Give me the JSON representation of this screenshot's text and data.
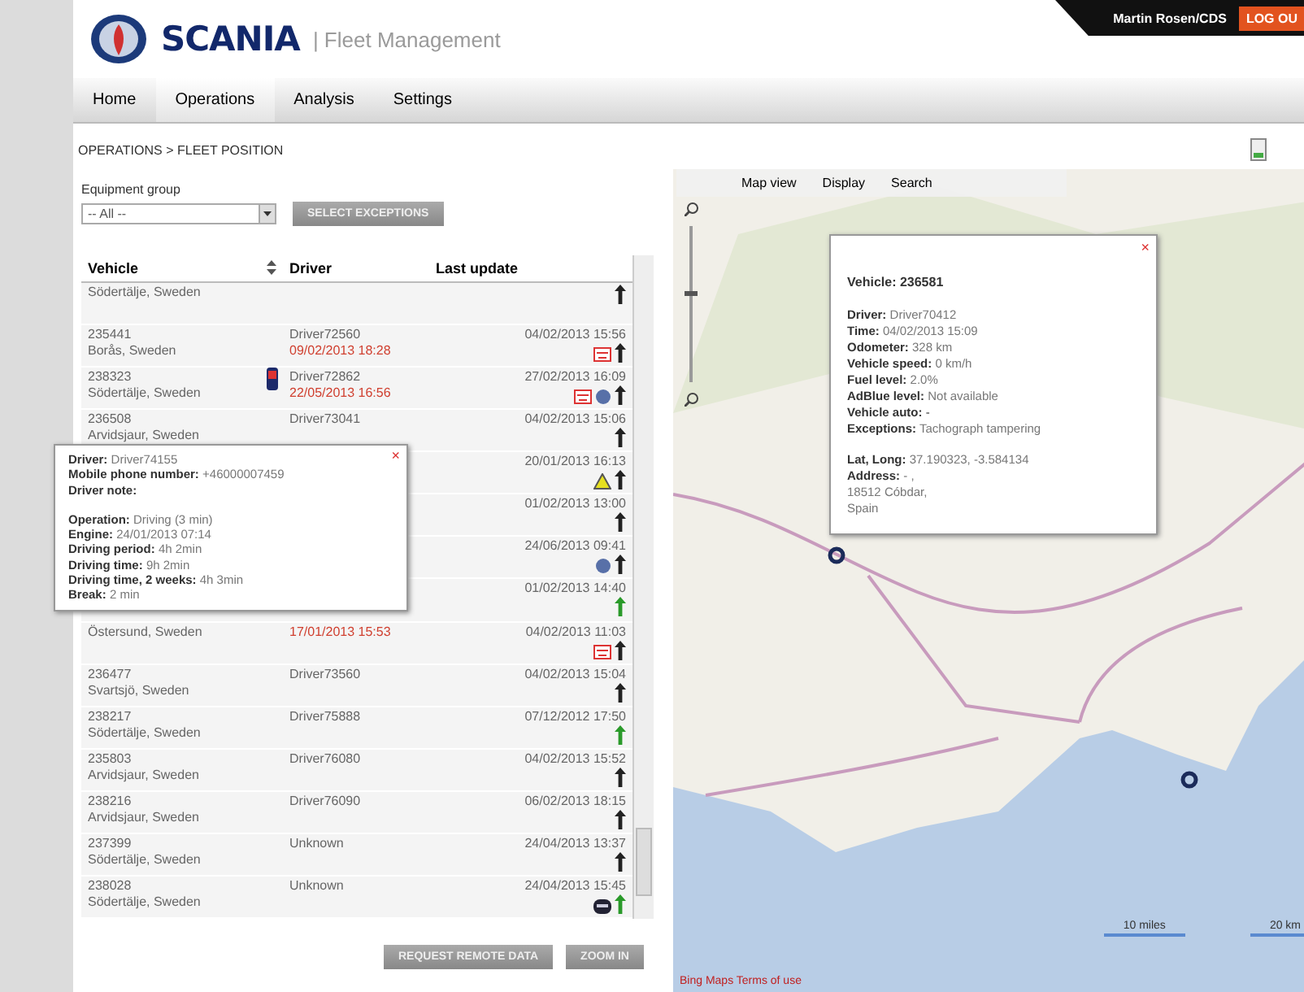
{
  "header": {
    "logo": "SCANIA",
    "app_title": "| Fleet Management",
    "user": "Martin Rosen/CDS",
    "logout": "LOG OU"
  },
  "nav": [
    {
      "label": "Home",
      "selected": false
    },
    {
      "label": "Operations",
      "selected": true
    },
    {
      "label": "Analysis",
      "selected": false
    },
    {
      "label": "Settings",
      "selected": false
    }
  ],
  "breadcrumb": "OPERATIONS > FLEET POSITION",
  "filter": {
    "label": "Equipment group",
    "value": "-- All --",
    "button": "SELECT EXCEPTIONS"
  },
  "list": {
    "columns": [
      "Vehicle",
      "Driver",
      "Last update"
    ],
    "rows": [
      {
        "location": "Södertälje, Sweden",
        "color": "#222222",
        "icons": []
      },
      {
        "vehicle": "235441",
        "location": "Borås, Sweden",
        "driver": "Driver72560",
        "driver_note": "09/02/2013 18:28",
        "time": "04/02/2013 15:56",
        "color": "#222222",
        "icons": [
          {
            "kind": "tacho"
          }
        ]
      },
      {
        "vehicle": "238323",
        "location": "Södertälje, Sweden",
        "driver": "Driver72862",
        "driver_note": "22/05/2013 16:56",
        "time": "27/02/2013 16:09",
        "color": "#222222",
        "phone": true,
        "icons": [
          {
            "kind": "tacho"
          },
          {
            "kind": "dot"
          }
        ]
      },
      {
        "vehicle": "236508",
        "location": "Arvidsjaur, Sweden",
        "driver": "Driver73041",
        "time": "04/02/2013 15:06",
        "color": "#222222",
        "icons": []
      },
      {
        "time": "20/01/2013 16:13",
        "color": "#222222",
        "icons": [
          {
            "kind": "warning"
          }
        ]
      },
      {
        "time": "01/02/2013 13:00",
        "color": "#222222",
        "icons": []
      },
      {
        "time": "24/06/2013 09:41",
        "color": "#222222",
        "icons": [
          {
            "kind": "dot"
          }
        ]
      },
      {
        "time": "01/02/2013 14:40",
        "color": "#2a9a2a",
        "icons": []
      },
      {
        "location": "Östersund, Sweden",
        "driver_note": "17/01/2013 15:53",
        "time": "04/02/2013 11:03",
        "color": "#222222",
        "icons": [
          {
            "kind": "tacho"
          }
        ]
      },
      {
        "vehicle": "236477",
        "location": "Svartsjö, Sweden",
        "driver": "Driver73560",
        "time": "04/02/2013 15:04",
        "color": "#222222",
        "icons": []
      },
      {
        "vehicle": "238217",
        "location": "Södertälje, Sweden",
        "driver": "Driver75888",
        "time": "07/12/2012 17:50",
        "color": "#2a9a2a",
        "icons": []
      },
      {
        "vehicle": "235803",
        "location": "Arvidsjaur, Sweden",
        "driver": "Driver76080",
        "time": "04/02/2013 15:52",
        "color": "#222222",
        "icons": []
      },
      {
        "vehicle": "238216",
        "location": "Arvidsjaur, Sweden",
        "driver": "Driver76090",
        "time": "06/02/2013 18:15",
        "color": "#222222",
        "icons": []
      },
      {
        "vehicle": "237399",
        "location": "Södertälje, Sweden",
        "driver": "Unknown",
        "time": "24/04/2013 13:37",
        "color": "#222222",
        "icons": []
      },
      {
        "vehicle": "238028",
        "location": "Södertälje, Sweden",
        "driver": "Unknown",
        "time": "24/04/2013 15:45",
        "color": "#2a9a2a",
        "icons": [
          {
            "kind": "card"
          }
        ]
      }
    ],
    "buttons": [
      "REQUEST REMOTE DATA",
      "ZOOM IN"
    ]
  },
  "driver_popup": {
    "close": "×",
    "lines": [
      {
        "label": "Driver:",
        "value": "Driver74155"
      },
      {
        "label": "Mobile phone number:",
        "value": "+46000007459"
      },
      {
        "label": "Driver note:"
      },
      {
        "label": "Operation:",
        "value": "Driving (3 min)",
        "gap": true
      },
      {
        "label": "Engine:",
        "value": "24/01/2013 07:14"
      },
      {
        "label": "Driving period:",
        "value": "4h 2min"
      },
      {
        "label": "Driving time:",
        "value": "9h 2min"
      },
      {
        "label": "Driving time, 2 weeks:",
        "value": "4h 3min"
      },
      {
        "label": "Break:",
        "value": "2 min"
      }
    ]
  },
  "map": {
    "tabs": [
      "Map view",
      "Display",
      "Search"
    ],
    "popup": {
      "close": "×",
      "title": "Vehicle: 236581",
      "lines": [
        {
          "label": "Driver:",
          "value": "Driver70412"
        },
        {
          "label": "Time:",
          "value": "04/02/2013 15:09"
        },
        {
          "label": "Odometer:",
          "value": "328 km"
        },
        {
          "label": "Vehicle speed:",
          "value": "0 km/h"
        },
        {
          "label": "Fuel level:",
          "value": "2.0%"
        },
        {
          "label": "AdBlue level:",
          "value": "Not available"
        },
        {
          "text": "**Vehicle auto:** -"
        },
        {
          "label": "Exceptions:",
          "value": "Tachograph tampering"
        },
        {
          "label": "Lat, Long:",
          "value": "37.190323, -3.584134",
          "gap": true
        },
        {
          "label": "Address:",
          "value": "- ,"
        },
        {
          "value": "18512 Cóbdar,"
        },
        {
          "value": "Spain"
        }
      ]
    },
    "zoom": {
      "level": 0.57
    },
    "scale": [
      "10 miles",
      "20 km"
    ],
    "terms": "Bing Maps Terms of use"
  }
}
